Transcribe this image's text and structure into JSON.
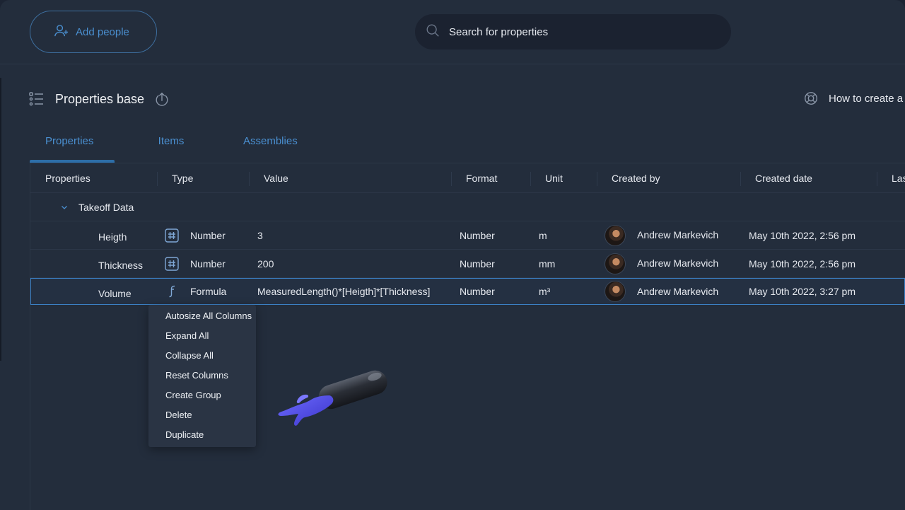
{
  "topbar": {
    "add_people_label": "Add people",
    "search_placeholder": "Search for properties"
  },
  "header": {
    "title": "Properties base",
    "help_link": "How to create a"
  },
  "tabs": [
    {
      "label": "Properties",
      "active": true
    },
    {
      "label": "Items",
      "active": false
    },
    {
      "label": "Assemblies",
      "active": false
    }
  ],
  "table": {
    "columns": [
      "Properties",
      "Type",
      "Value",
      "Format",
      "Unit",
      "Created by",
      "Created date",
      "Las"
    ],
    "group": {
      "label": "Takeoff Data",
      "expanded": true
    },
    "rows": [
      {
        "name": "Heigth",
        "type": "Number",
        "type_icon": "hash-icon",
        "value": "3",
        "format": "Number",
        "unit": "m",
        "created_by": "Andrew Markevich",
        "created_date": "May 10th 2022, 2:56 pm"
      },
      {
        "name": "Thickness",
        "type": "Number",
        "type_icon": "hash-icon",
        "value": "200",
        "format": "Number",
        "unit": "mm",
        "created_by": "Andrew Markevich",
        "created_date": "May 10th 2022, 2:56 pm"
      },
      {
        "name": "Volume",
        "type": "Formula",
        "type_icon": "function-icon",
        "value": "MeasuredLength()*[Heigth]*[Thickness]",
        "format": "Number",
        "unit": "m³",
        "created_by": "Andrew Markevich",
        "created_date": "May 10th 2022, 3:27 pm",
        "selected": true
      }
    ]
  },
  "context_menu": {
    "items": [
      "Autosize All Columns",
      "Expand All",
      "Collapse All",
      "Reset Columns",
      "Create Group",
      "Delete",
      "Duplicate"
    ]
  },
  "colors": {
    "background": "#232d3c",
    "accent": "#4a8fd0",
    "selection_border": "#3b80c4",
    "menu_bg": "#2a3444"
  }
}
